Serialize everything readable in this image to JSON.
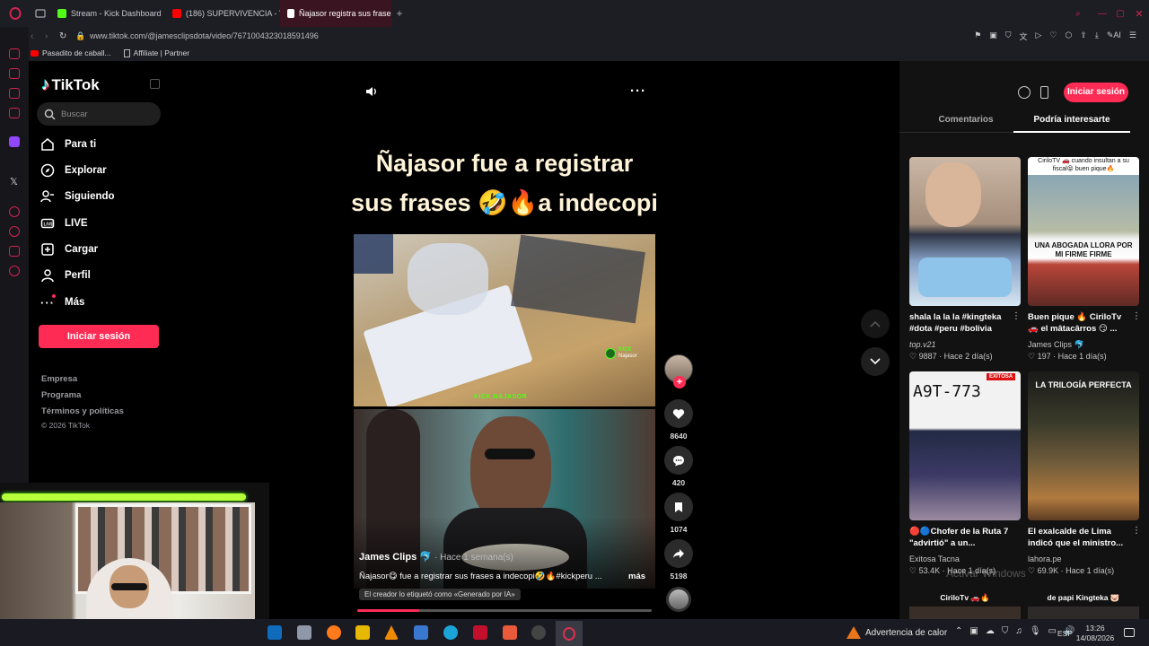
{
  "browser": {
    "tabs": [
      {
        "label": "Stream - Kick Dashboard",
        "color": "#53fc18"
      },
      {
        "label": "(186) SUPERVIVENCIA - Yo",
        "color": "#ff0000"
      },
      {
        "label": "Ñajasor registra sus frases",
        "color": "#ffffff"
      }
    ],
    "url": "www.tiktok.com/@jamesclipsdota/video/7671004323018591496",
    "bookmarks": [
      "Pasadito de caball...",
      "Affiliate | Partner"
    ],
    "accent": "#d2244f"
  },
  "tiktok": {
    "logo": "TikTok",
    "search_placeholder": "Buscar",
    "nav": [
      "Para ti",
      "Explorar",
      "Siguiendo",
      "LIVE",
      "Cargar",
      "Perfil",
      "Más"
    ],
    "login_label": "Iniciar sesión",
    "footer": [
      "Empresa",
      "Programa",
      "Términos y políticas",
      "© 2026 TikTok"
    ],
    "brand_color": "#fe2c55",
    "video": {
      "overlay_title_line1": "Ñajasor fue a registrar",
      "overlay_title_line2": "sus frases 🤣🔥a indecopi",
      "watermark_channel": "KICK",
      "watermark_sub": "Najasor",
      "watermark_caption": "KICK.NAJASOR",
      "author": "James Clips 🐬",
      "time": "Hace 1 semana(s)",
      "caption": "Ñajasor😋 fue a registrar sus frases a indecopi🤣🔥#kickperu ...",
      "more": "más",
      "ai_label": "El creador lo etiquetó como «Generado por IA»"
    },
    "actions": {
      "likes": "8640",
      "comments": "420",
      "saves": "1074",
      "shares": "5198"
    },
    "right_panel": {
      "login_label": "Iniciar sesión",
      "tabs": [
        "Comentarios",
        "Podría interesarte"
      ],
      "cards": [
        {
          "title": "shala la la la #kingteka #dota #peru #bolivia",
          "author": "top.v21",
          "likes": "9887",
          "time": "Hace 2 día(s)",
          "thumb_text": ""
        },
        {
          "title": "Buen pique 🔥 CiriloTv 🚗 el mâtacârros 😏 ...",
          "author": "James Clips 🐬",
          "likes": "197",
          "time": "Hace 1 día(s)",
          "thumb_text": "UNA ABOGADA LLORA POR MI FIRME FIRME",
          "thumb_top": "CiriloTV 🚗 cuando insultan a su fiscal😝 buen pique🔥"
        },
        {
          "title": "🔴🔵Chofer de la Ruta 7 \"advirtió\" a un...",
          "author": "Exitosa Tacna",
          "likes": "53.4K",
          "time": "Hace 1 día(s)",
          "thumb_text": "A9T-773",
          "thumb_badge": "EXITOSA"
        },
        {
          "title": "El exalcalde de Lima indicó que el ministro...",
          "author": "lahora.pe",
          "likes": "69.9K",
          "time": "Hace 1 día(s)",
          "thumb_text": "LA TRILOGÍA PERFECTA"
        }
      ],
      "next_row": [
        "CiriloTv 🚗🔥",
        "de papi Kingteka 🐷"
      ]
    },
    "watermark_os": "Activar Windows"
  },
  "taskbar": {
    "alert": "Advertencia de calor",
    "lang": "ESP",
    "time": "13:26",
    "date": "14/08/2026"
  }
}
